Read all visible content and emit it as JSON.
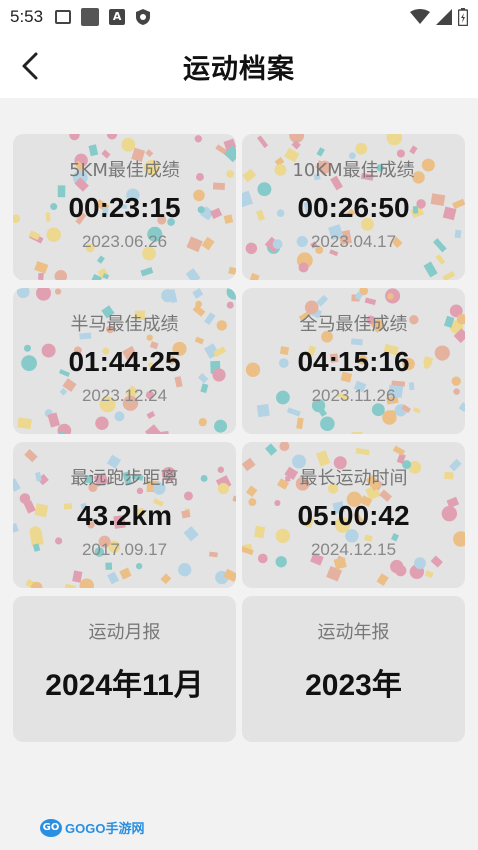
{
  "status_bar": {
    "time": "5:53",
    "icons": [
      "image-icon",
      "square-icon",
      "a-icon",
      "shield-icon",
      "wifi-icon",
      "signal-icon",
      "battery-icon"
    ]
  },
  "header": {
    "title": "运动档案",
    "back_icon": "chevron-left-icon"
  },
  "cards": [
    {
      "label": "5KM最佳成绩",
      "value": "00:23:15",
      "date": "2023.06.26"
    },
    {
      "label": "10KM最佳成绩",
      "value": "00:26:50",
      "date": "2023.04.17"
    },
    {
      "label": "半马最佳成绩",
      "value": "01:44:25",
      "date": "2023.12.24"
    },
    {
      "label": "全马最佳成绩",
      "value": "04:15:16",
      "date": "2023.11.26"
    },
    {
      "label": "最远跑步距离",
      "value": "43.2km",
      "date": "2017.09.17"
    },
    {
      "label": "最长运动时间",
      "value": "05:00:42",
      "date": "2024.12.15"
    }
  ],
  "reports": [
    {
      "label": "运动月报",
      "value": "2024年11月"
    },
    {
      "label": "运动年报",
      "value": "2023年"
    }
  ],
  "watermark": {
    "logo": "GO",
    "text": "GOGO手游网"
  },
  "colors": {
    "background": "#f2f2f2",
    "card": "#e3e3e3",
    "confetti": [
      "#e06b8b",
      "#f2a33a",
      "#3cb7b7",
      "#f5d04a",
      "#8fc8e8",
      "#e88a6a"
    ]
  }
}
